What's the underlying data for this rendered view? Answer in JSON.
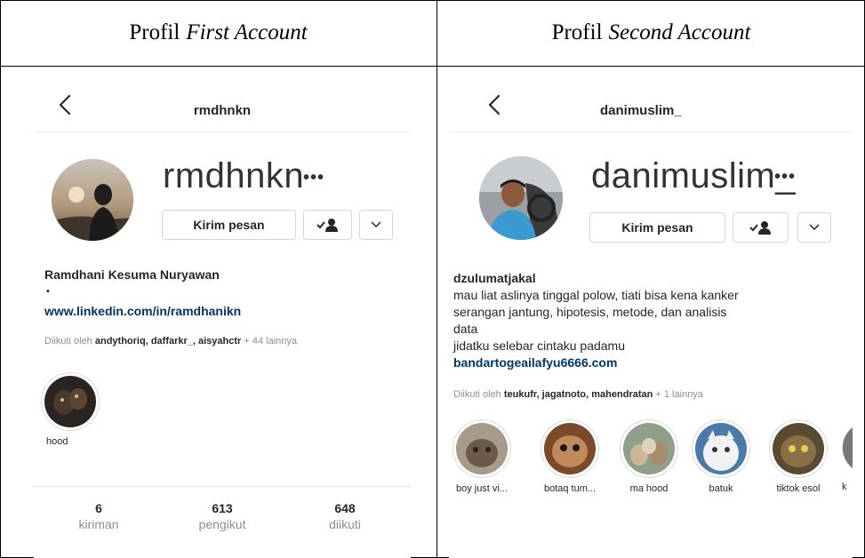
{
  "headers": {
    "left": {
      "prefix": "Profil",
      "italic": "First Account"
    },
    "right": {
      "prefix": "Profil",
      "italic": "Second Account"
    }
  },
  "first": {
    "top_title": "rmdhnkn",
    "username": "rmdhnkn",
    "more": "•••",
    "message_button": "Kirim pesan",
    "bio_name": "Ramdhani Kesuma Nuryawan",
    "bio_line": "•",
    "link": "www.linkedin.com/in/ramdhanikn",
    "followed_prefix": "Diikuti oleh",
    "followed_names": "andythoriq, daffarkr_, aisyahctr",
    "followed_suffix": "+ 44 lainnya",
    "highlights": [
      {
        "label": "hood"
      }
    ],
    "stats": [
      {
        "num": "6",
        "label": "kiriman"
      },
      {
        "num": "613",
        "label": "pengikut"
      },
      {
        "num": "648",
        "label": "diikuti"
      }
    ]
  },
  "second": {
    "top_title": "danimuslim_",
    "username": "danimuslim_",
    "more": "•••",
    "message_button": "Kirim pesan",
    "bio_name": "dzulumatjakal",
    "bio_lines": [
      "mau liat aslinya tinggal polow, tiati bisa kena kanker",
      "serangan jantung, hipotesis, metode, dan analisis",
      "data",
      "jidatku selebar cintaku padamu"
    ],
    "link": "bandartogeailafyu6666.com",
    "followed_prefix": "Diikuti oleh",
    "followed_names": "teukufr, jagatnoto, mahendratan",
    "followed_suffix": "+ 1 lainnya",
    "highlights": [
      {
        "label": "boy just vi..."
      },
      {
        "label": "botaq tum..."
      },
      {
        "label": "ma hood"
      },
      {
        "label": "batuk"
      },
      {
        "label": "tiktok esol"
      },
      {
        "label": "k"
      }
    ]
  },
  "icons": {
    "back": "chevron-left-icon",
    "follow_check": "person-check-icon",
    "dropdown": "chevron-down-icon"
  }
}
